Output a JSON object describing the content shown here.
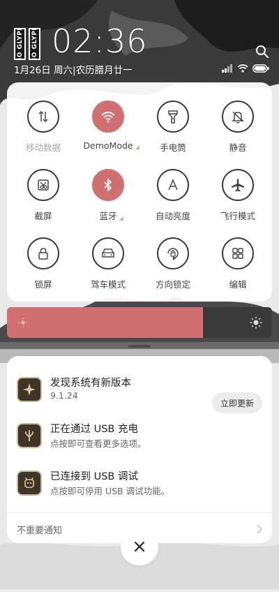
{
  "header": {
    "clock": "02:36",
    "date": "1月26日 周六|农历腊月廿一",
    "logo_text": "NO GLYPH"
  },
  "toggles": [
    {
      "label": "移动数据",
      "icon": "mobile-data-icon",
      "on": false,
      "dim": true
    },
    {
      "label": "DemoMode",
      "icon": "wifi-icon",
      "on": true,
      "dim": false,
      "more": true
    },
    {
      "label": "手电筒",
      "icon": "flashlight-icon",
      "on": false,
      "dim": false
    },
    {
      "label": "静音",
      "icon": "mute-bell-icon",
      "on": false,
      "dim": false
    },
    {
      "label": "截屏",
      "icon": "screenshot-icon",
      "on": false,
      "dim": false
    },
    {
      "label": "蓝牙",
      "icon": "bluetooth-icon",
      "on": true,
      "dim": false,
      "more": true
    },
    {
      "label": "自动亮度",
      "icon": "auto-brightness-icon",
      "on": false,
      "dim": false
    },
    {
      "label": "飞行模式",
      "icon": "airplane-icon",
      "on": false,
      "dim": false
    },
    {
      "label": "锁屏",
      "icon": "lock-icon",
      "on": false,
      "dim": false
    },
    {
      "label": "驾车模式",
      "icon": "car-icon",
      "on": false,
      "dim": false
    },
    {
      "label": "方向锁定",
      "icon": "rotation-lock-icon",
      "on": false,
      "dim": false
    },
    {
      "label": "编辑",
      "icon": "edit-grid-icon",
      "on": false,
      "dim": false
    }
  ],
  "brightness": {
    "level": 0.74
  },
  "notifications": [
    {
      "title": "发现系统有新版本",
      "subtitle": "9.1.24",
      "button": "立即更新"
    },
    {
      "title": "正在通过 USB 充电",
      "subtitle": "点按即可查看更多选项。"
    },
    {
      "title": "已连接到 USB 调试",
      "subtitle": "点按即可停用 USB 调试功能。"
    }
  ],
  "unimportant_label": "不重要通知",
  "colors": {
    "accent": "#d17070",
    "panel": "#ffffff"
  }
}
